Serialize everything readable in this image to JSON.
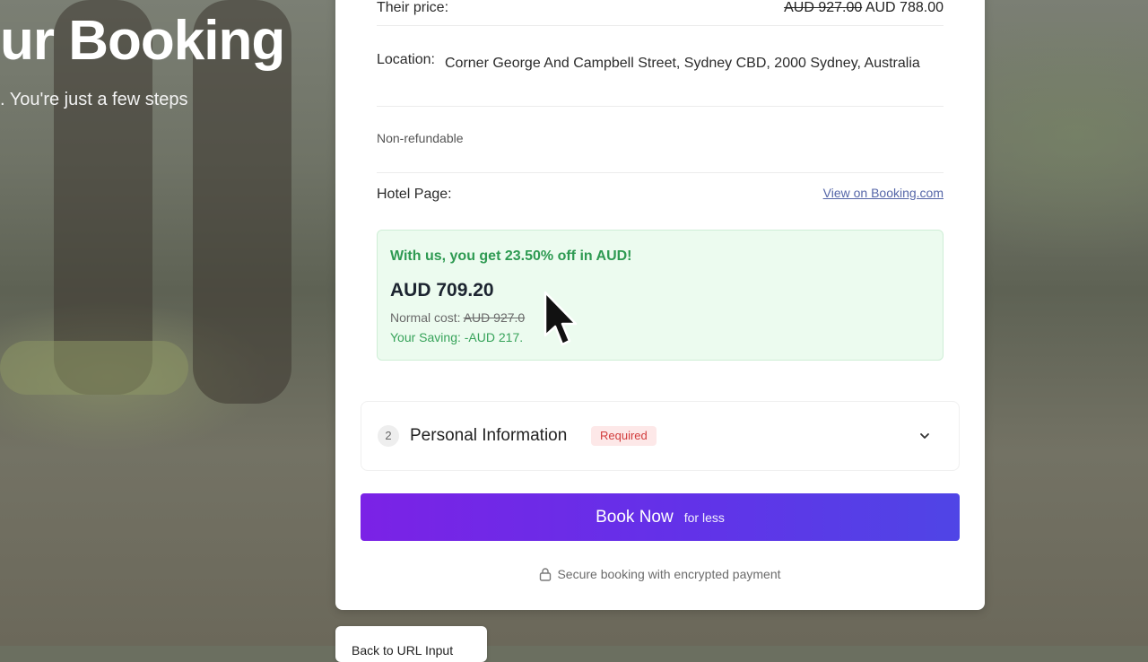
{
  "hero": {
    "title": "ur Booking",
    "subtitle": ". You're just a few steps"
  },
  "details": {
    "their_price_label": "Their price:",
    "their_price_original": "AUD 927.00",
    "their_price_current": "AUD 788.00",
    "location_label": "Location:",
    "location_value": "Corner George And Campbell Street, Sydney CBD, 2000 Sydney, Australia",
    "refund_policy": "Non-refundable",
    "hotel_page_label": "Hotel Page:",
    "hotel_page_link": "View on Booking.com"
  },
  "deal": {
    "headline": "With us, you get 23.50% off in AUD!",
    "price": "AUD 709.20",
    "normal_cost_label": "Normal cost:",
    "normal_cost_value": "AUD 927.0",
    "saving_text": "Your Saving: -AUD 217.",
    "accent_color": "#2e9a52"
  },
  "personal_section": {
    "step_number": "2",
    "title": "Personal Information",
    "badge": "Required",
    "icon": "chevron-down-icon"
  },
  "book_button": {
    "label": "Book Now",
    "sublabel": "for less",
    "gradient_start": "#7b22e6",
    "gradient_end": "#4f45e6"
  },
  "secure_note": {
    "text": "Secure booking with encrypted payment",
    "icon": "lock-icon"
  },
  "back_button": {
    "label": "Back to URL Input"
  }
}
